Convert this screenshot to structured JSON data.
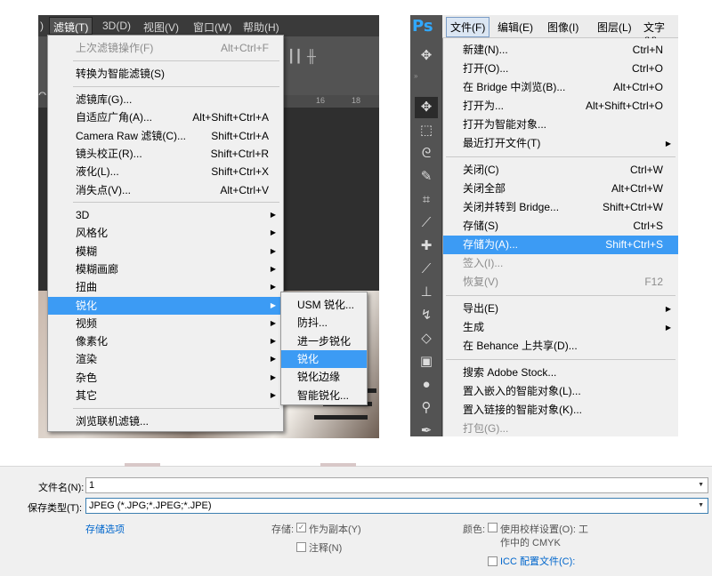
{
  "filter_panel": {
    "menubar": [
      "滤镜(T)",
      "3D(D)",
      "视图(V)",
      "窗口(W)",
      "帮助(H)"
    ],
    "ruler_ticks": [
      "16",
      "18"
    ],
    "menu": {
      "last_filter": {
        "label": "上次滤镜操作(F)",
        "shortcut": "Alt+Ctrl+F"
      },
      "convert_smart": "转换为智能滤镜(S)",
      "items": [
        {
          "label": "滤镜库(G)...",
          "shortcut": ""
        },
        {
          "label": "自适应广角(A)...",
          "shortcut": "Alt+Shift+Ctrl+A"
        },
        {
          "label": "Camera Raw 滤镜(C)...",
          "shortcut": "Shift+Ctrl+A"
        },
        {
          "label": "镜头校正(R)...",
          "shortcut": "Shift+Ctrl+R"
        },
        {
          "label": "液化(L)...",
          "shortcut": "Shift+Ctrl+X"
        },
        {
          "label": "消失点(V)...",
          "shortcut": "Alt+Ctrl+V"
        }
      ],
      "submenus": [
        "3D",
        "风格化",
        "模糊",
        "模糊画廊",
        "扭曲",
        "锐化",
        "视频",
        "像素化",
        "渲染",
        "杂色",
        "其它"
      ],
      "browse": "浏览联机滤镜..."
    },
    "sharpen_submenu": [
      "USM 锐化...",
      "防抖...",
      "进一步锐化",
      "锐化",
      "锐化边缘",
      "智能锐化..."
    ]
  },
  "file_panel": {
    "logo": "Ps",
    "menubar": [
      "文件(F)",
      "编辑(E)",
      "图像(I)",
      "图层(L)",
      "文字(Y)"
    ],
    "groups": [
      [
        {
          "label": "新建(N)...",
          "shortcut": "Ctrl+N"
        },
        {
          "label": "打开(O)...",
          "shortcut": "Ctrl+O"
        },
        {
          "label": "在 Bridge 中浏览(B)...",
          "shortcut": "Alt+Ctrl+O"
        },
        {
          "label": "打开为...",
          "shortcut": "Alt+Shift+Ctrl+O"
        },
        {
          "label": "打开为智能对象...",
          "shortcut": ""
        },
        {
          "label": "最近打开文件(T)",
          "shortcut": "",
          "submenu": true
        }
      ],
      [
        {
          "label": "关闭(C)",
          "shortcut": "Ctrl+W"
        },
        {
          "label": "关闭全部",
          "shortcut": "Alt+Ctrl+W"
        },
        {
          "label": "关闭并转到 Bridge...",
          "shortcut": "Shift+Ctrl+W"
        },
        {
          "label": "存储(S)",
          "shortcut": "Ctrl+S"
        },
        {
          "label": "存储为(A)...",
          "shortcut": "Shift+Ctrl+S",
          "highlight": true
        },
        {
          "label": "签入(I)...",
          "shortcut": "",
          "disabled": true
        },
        {
          "label": "恢复(V)",
          "shortcut": "F12",
          "disabled": true
        }
      ],
      [
        {
          "label": "导出(E)",
          "shortcut": "",
          "submenu": true
        },
        {
          "label": "生成",
          "shortcut": "",
          "submenu": true
        },
        {
          "label": "在 Behance 上共享(D)...",
          "shortcut": ""
        }
      ],
      [
        {
          "label": "搜索 Adobe Stock...",
          "shortcut": ""
        },
        {
          "label": "置入嵌入的智能对象(L)...",
          "shortcut": ""
        },
        {
          "label": "置入链接的智能对象(K)...",
          "shortcut": ""
        },
        {
          "label": "打包(G)...",
          "shortcut": "",
          "disabled": true
        }
      ]
    ]
  },
  "save_dialog": {
    "filename_label": "文件名(N):",
    "filename_value": "1",
    "type_label": "保存类型(T):",
    "type_value": "JPEG (*.JPG;*.JPEG;*.JPE)",
    "save_options_link": "存储选项",
    "save_label": "存储:",
    "as_copy": "作为副本(Y)",
    "notes": "注释(N)",
    "color_label": "颜色:",
    "proof_setup": "使用校样设置(O): 工",
    "proof_setup_line2": "作中的 CMYK",
    "icc": "ICC 配置文件(C):"
  },
  "colors": {
    "highlight": "#3c9bf4",
    "ps_blue": "#31a8ff",
    "menu_bg": "#f0f0f0",
    "link": "#0066cc"
  }
}
